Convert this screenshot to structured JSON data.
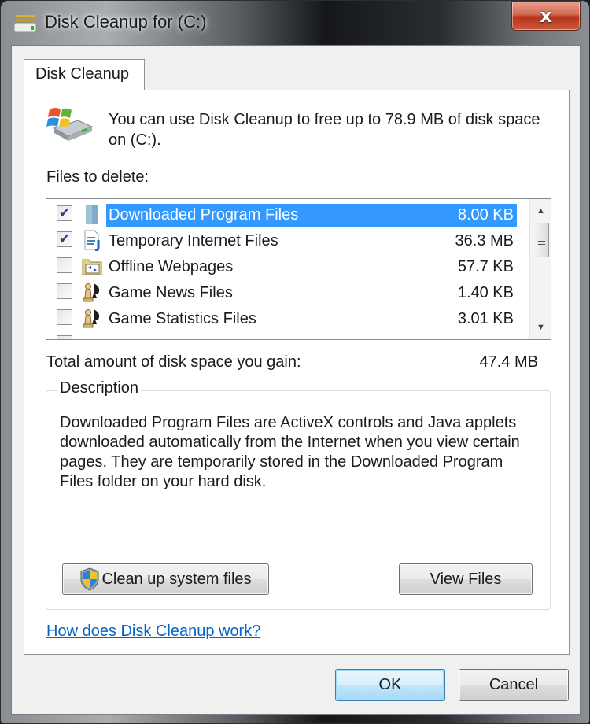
{
  "window": {
    "title": "Disk Cleanup for  (C:)",
    "close_label": "x",
    "icon": "disk-cleanup-icon"
  },
  "tabs": [
    {
      "label": "Disk Cleanup",
      "active": true
    }
  ],
  "header": {
    "icon": "windows-drive-icon",
    "text": "You can use Disk Cleanup to free up to 78.9 MB of disk space on  (C:)."
  },
  "files": {
    "label": "Files to delete:",
    "items": [
      {
        "name": "Downloaded Program Files",
        "size": "8.00 KB",
        "checked": true,
        "selected": true,
        "icon": "folder-icon"
      },
      {
        "name": "Temporary Internet Files",
        "size": "36.3 MB",
        "checked": true,
        "selected": false,
        "icon": "document-icon"
      },
      {
        "name": "Offline Webpages",
        "size": "57.7 KB",
        "checked": false,
        "selected": false,
        "icon": "sync-folder-icon"
      },
      {
        "name": "Game News Files",
        "size": "1.40 KB",
        "checked": false,
        "selected": false,
        "icon": "game-chess-icon"
      },
      {
        "name": "Game Statistics Files",
        "size": "3.01 KB",
        "checked": false,
        "selected": false,
        "icon": "game-chess-icon"
      }
    ],
    "check_glyph": "✔"
  },
  "scrollbar": {
    "up": "▲",
    "down": "▼"
  },
  "total": {
    "label": "Total amount of disk space you gain:",
    "value": "47.4 MB"
  },
  "description": {
    "title": "Description",
    "text": "Downloaded Program Files are ActiveX controls and Java applets downloaded automatically from the Internet when you view certain pages. They are temporarily stored in the Downloaded Program Files folder on your hard disk."
  },
  "buttons": {
    "cleanup_system": "Clean up system files",
    "view_files": "View Files",
    "ok": "OK",
    "cancel": "Cancel"
  },
  "help_link": "How does Disk Cleanup work?",
  "colors": {
    "selection": "#3399ff",
    "link": "#0066cc",
    "close_red": "#c9452a"
  }
}
